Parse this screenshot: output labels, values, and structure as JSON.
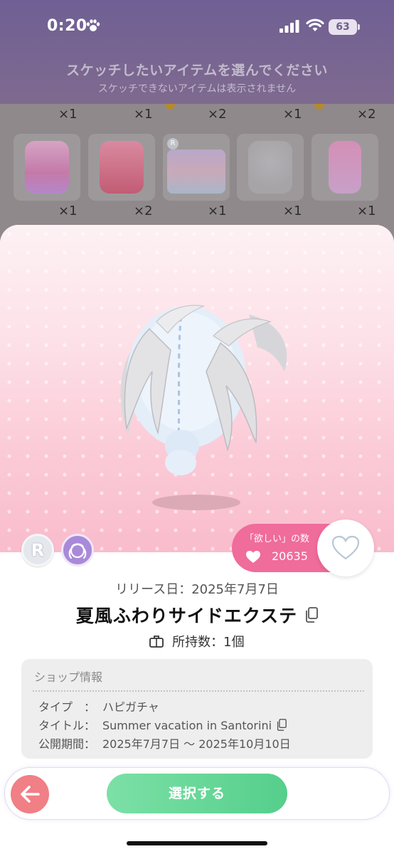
{
  "status_bar": {
    "time": "0:20",
    "battery": "63"
  },
  "instruction": {
    "main": "スケッチしたいアイテムを選んでください",
    "sub": "スケッチできないアイテムは表示されません"
  },
  "grid": {
    "top_row_counts": [
      "×1",
      "×1",
      "×2",
      "×1",
      "×2"
    ],
    "tiles": [
      {
        "count": "×1",
        "icon": "pink-dress-item"
      },
      {
        "count": "×2",
        "icon": "red-cardigan-item"
      },
      {
        "count": "×1",
        "icon": "rainbow-cloud-background-item"
      },
      {
        "count": "×1",
        "icon": "chain-necklace-item"
      },
      {
        "count": "×1",
        "icon": "pink-flip-phone-item"
      }
    ]
  },
  "item": {
    "want_label": "「欲しい」の数",
    "want_count": "20635",
    "rarity": "R",
    "release": "リリース日：2025年7月7日",
    "name": "夏風ふわりサイドエクステ",
    "owned": "所持数：1個"
  },
  "shop": {
    "heading": "ショップ情報",
    "rows": [
      {
        "key": "タイプ　：",
        "value": "ハピガチャ"
      },
      {
        "key": "タイトル：",
        "value": "Summer vacation in Santorini"
      },
      {
        "key": "公開期間：",
        "value": "2025年7月7日 ～ 2025年10月10日"
      }
    ]
  },
  "actions": {
    "select_label": "選択する"
  },
  "colors": {
    "accent_pink": "#f06c9a",
    "select_green": "#55cf8b",
    "back_red": "#f07f86",
    "header_purple": "#6f5f94"
  }
}
